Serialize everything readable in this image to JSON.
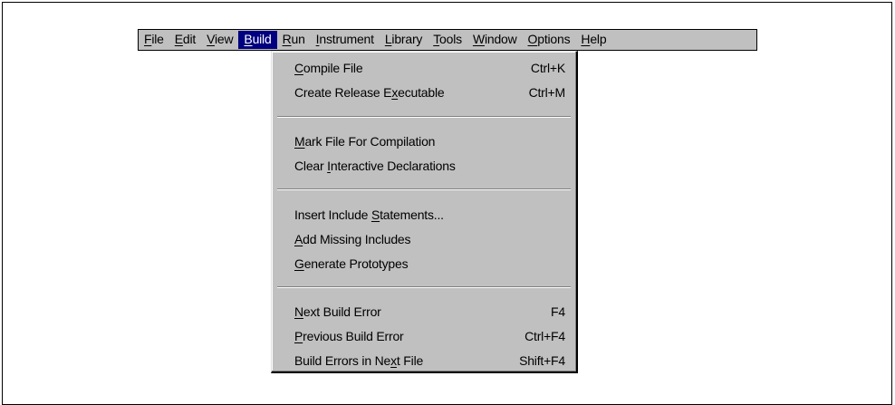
{
  "menubar": {
    "items": [
      {
        "label": "File",
        "mnemonic": "F",
        "rest": "ile"
      },
      {
        "label": "Edit",
        "mnemonic": "E",
        "rest": "dit"
      },
      {
        "label": "View",
        "mnemonic": "V",
        "rest": "iew"
      },
      {
        "label": "Build",
        "mnemonic": "B",
        "rest": "uild",
        "active": true
      },
      {
        "label": "Run",
        "mnemonic": "R",
        "rest": "un"
      },
      {
        "label": "Instrument",
        "mnemonic": "I",
        "rest": "nstrument"
      },
      {
        "label": "Library",
        "mnemonic": "L",
        "rest": "ibrary"
      },
      {
        "label": "Tools",
        "mnemonic": "T",
        "rest": "ools"
      },
      {
        "label": "Window",
        "mnemonic": "W",
        "rest": "indow"
      },
      {
        "label": "Options",
        "mnemonic": "O",
        "rest": "ptions"
      },
      {
        "label": "Help",
        "mnemonic": "H",
        "rest": "elp"
      }
    ]
  },
  "build_menu": {
    "compile_file": {
      "pre": "",
      "mn": "C",
      "post": "ompile File",
      "shortcut": "Ctrl+K"
    },
    "create_release": {
      "pre": "Create Release E",
      "mn": "x",
      "post": "ecutable",
      "shortcut": "Ctrl+M"
    },
    "mark_file": {
      "pre": "",
      "mn": "M",
      "post": "ark File For Compilation",
      "shortcut": ""
    },
    "clear_interactive": {
      "pre": "Clear ",
      "mn": "I",
      "post": "nteractive Declarations",
      "shortcut": ""
    },
    "insert_include": {
      "pre": "Insert Include ",
      "mn": "S",
      "post": "tatements...",
      "shortcut": ""
    },
    "add_missing": {
      "pre": "",
      "mn": "A",
      "post": "dd Missing Includes",
      "shortcut": ""
    },
    "generate_prototypes": {
      "pre": "",
      "mn": "G",
      "post": "enerate Prototypes",
      "shortcut": ""
    },
    "next_error": {
      "pre": "",
      "mn": "N",
      "post": "ext Build Error",
      "shortcut": "F4"
    },
    "previous_error": {
      "pre": "",
      "mn": "P",
      "post": "revious Build Error",
      "shortcut": "Ctrl+F4"
    },
    "errors_next_file": {
      "pre": "Build Errors in Ne",
      "mn": "x",
      "post": "t File",
      "shortcut": "Shift+F4"
    }
  },
  "colors": {
    "menu_background": "#c0c0c0",
    "highlight": "#000080",
    "highlight_text": "#ffffff"
  }
}
